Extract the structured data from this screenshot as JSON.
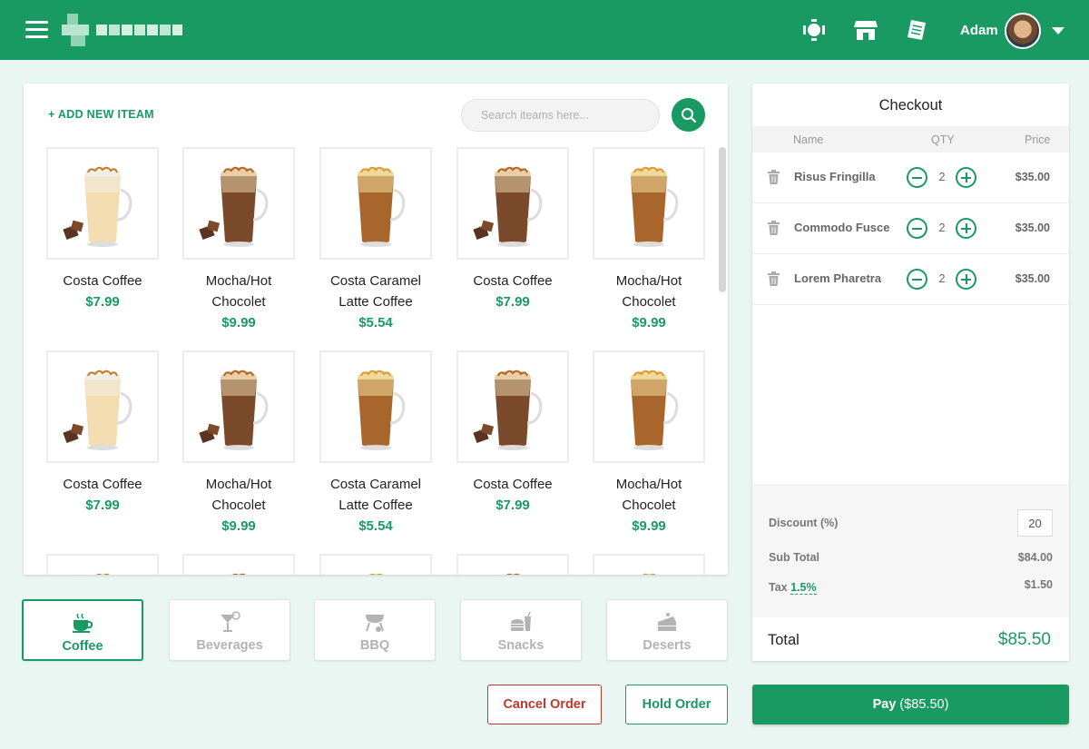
{
  "header": {
    "user_name": "Adam",
    "icons": [
      "waiter-icon",
      "store-icon",
      "receipt-icon"
    ]
  },
  "products": {
    "add_item_label": "+ ADD NEW ITEAM",
    "search_placeholder": "Search iteams here...",
    "items": [
      {
        "name_line1": "Costa Coffee",
        "name_line2": "",
        "price": "$7.99",
        "image": "latte-glass"
      },
      {
        "name_line1": "Mocha/Hot",
        "name_line2": "Chocolet",
        "price": "$9.99",
        "image": "mocha-glass"
      },
      {
        "name_line1": "Costa Caramel",
        "name_line2": "Latte Coffee",
        "price": "$5.54",
        "image": "caramel-glass"
      },
      {
        "name_line1": "Costa Coffee",
        "name_line2": "",
        "price": "$7.99",
        "image": "mocha-glass"
      },
      {
        "name_line1": "Mocha/Hot",
        "name_line2": "Chocolet",
        "price": "$9.99",
        "image": "caramel-glass"
      },
      {
        "name_line1": "Costa Coffee",
        "name_line2": "",
        "price": "$7.99",
        "image": "latte-glass"
      },
      {
        "name_line1": "Mocha/Hot",
        "name_line2": "Chocolet",
        "price": "$9.99",
        "image": "mocha-glass"
      },
      {
        "name_line1": "Costa Caramel",
        "name_line2": "Latte Coffee",
        "price": "$5.54",
        "image": "caramel-glass"
      },
      {
        "name_line1": "Costa Coffee",
        "name_line2": "",
        "price": "$7.99",
        "image": "mocha-glass"
      },
      {
        "name_line1": "Mocha/Hot",
        "name_line2": "Chocolet",
        "price": "$9.99",
        "image": "caramel-glass"
      }
    ]
  },
  "categories": [
    {
      "label": "Coffee",
      "icon": "coffee-cup-icon",
      "active": true
    },
    {
      "label": "Beverages",
      "icon": "cocktail-icon",
      "active": false
    },
    {
      "label": "BBQ",
      "icon": "grill-icon",
      "active": false
    },
    {
      "label": "Snacks",
      "icon": "burger-drink-icon",
      "active": false
    },
    {
      "label": "Deserts",
      "icon": "cake-icon",
      "active": false
    }
  ],
  "actions": {
    "cancel_label": "Cancel Order",
    "hold_label": "Hold Order",
    "pay_label": "Pay",
    "pay_amount": "($85.50)"
  },
  "checkout": {
    "title": "Checkout",
    "col_name": "Name",
    "col_qty": "QTY",
    "col_price": "Price",
    "items": [
      {
        "name": "Risus Fringilla",
        "qty": "2",
        "price": "$35.00"
      },
      {
        "name": "Commodo Fusce",
        "qty": "2",
        "price": "$35.00"
      },
      {
        "name": "Lorem Pharetra",
        "qty": "2",
        "price": "$35.00"
      }
    ],
    "discount_label": "Discount (%)",
    "discount_value": "20",
    "subtotal_label": "Sub Total",
    "subtotal_value": "$84.00",
    "tax_label": "Tax",
    "tax_rate": "1.5%",
    "tax_value": "$1.50",
    "total_label": "Total",
    "total_value": "$85.50"
  },
  "colors": {
    "brand": "#1a9a63",
    "danger": "#c0392b",
    "background": "#eaf6f1"
  }
}
